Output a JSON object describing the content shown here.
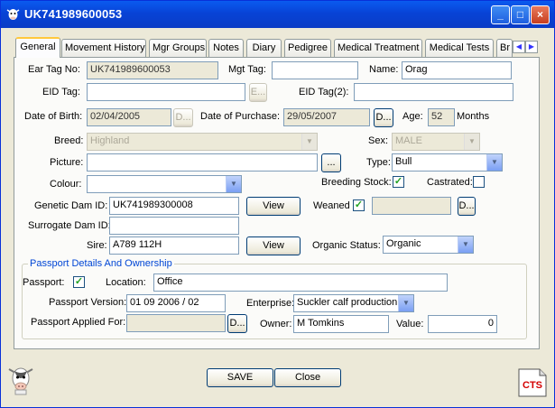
{
  "window": {
    "title": "UK741989600053",
    "minimize": "_",
    "maximize": "□",
    "close": "×"
  },
  "tabs": [
    "General",
    "Movement History",
    "Mgr Groups",
    "Notes",
    "Diary",
    "Pedigree",
    "Medical Treatment",
    "Medical Tests",
    "Br"
  ],
  "tab_arrows": {
    "left": "◀",
    "right": "▶"
  },
  "general": {
    "ear_tag_label": "Ear Tag No:",
    "ear_tag_value": "UK741989600053",
    "mgt_tag_label": "Mgt Tag:",
    "mgt_tag_value": "",
    "name_label": "Name:",
    "name_value": "Orag",
    "eid_tag_label": "EID Tag:",
    "eid_tag_value": "",
    "eid_button": "E...",
    "eid_tag2_label": "EID Tag(2):",
    "eid_tag2_value": "",
    "dob_label": "Date of Birth:",
    "dob_value": "02/04/2005",
    "dob_button": "D...",
    "dop_label": "Date of Purchase:",
    "dop_value": "29/05/2007",
    "dop_button": "D...",
    "age_label": "Age:",
    "age_value": "52",
    "age_unit": "Months",
    "breed_label": "Breed:",
    "breed_value": "Highland",
    "sex_label": "Sex:",
    "sex_value": "MALE",
    "picture_label": "Picture:",
    "picture_value": "",
    "picture_button": "...",
    "type_label": "Type:",
    "type_value": "Bull",
    "colour_label": "Colour:",
    "colour_value": "",
    "breeding_stock_label": "Breeding Stock:",
    "breeding_stock_checked": "✓",
    "castrated_label": "Castrated:",
    "castrated_checked": "",
    "genetic_dam_label": "Genetic Dam ID:",
    "genetic_dam_value": "UK741989300008",
    "view_label": "View",
    "weaned_label": "Weaned",
    "weaned_checked": "✓",
    "weaned_date": "",
    "weaned_button": "D...",
    "surrogate_dam_label": "Surrogate Dam ID:",
    "surrogate_dam_value": "",
    "sire_label": "Sire:",
    "sire_value": "A789 112H",
    "organic_status_label": "Organic Status:",
    "organic_status_value": "Organic"
  },
  "passport": {
    "group_title": "Passport Details And Ownership",
    "passport_label": "Passport:",
    "passport_checked": "✓",
    "location_label": "Location:",
    "location_value": "Office",
    "version_label": "Passport Version:",
    "version_value": "01 09 2006 / 02",
    "enterprise_label": "Enterprise:",
    "enterprise_value": "Suckler calf production",
    "applied_label": "Passport Applied For:",
    "applied_value": "",
    "applied_button": "D...",
    "owner_label": "Owner:",
    "owner_value": "M Tomkins",
    "value_label": "Value:",
    "value_value": "0"
  },
  "footer": {
    "save": "SAVE",
    "close": "Close",
    "logo_text": "CTS"
  },
  "colors": {
    "titlebar": "#0843d6",
    "group_title": "#0046d5",
    "check": "#21a121",
    "cts_red": "#d40000"
  }
}
